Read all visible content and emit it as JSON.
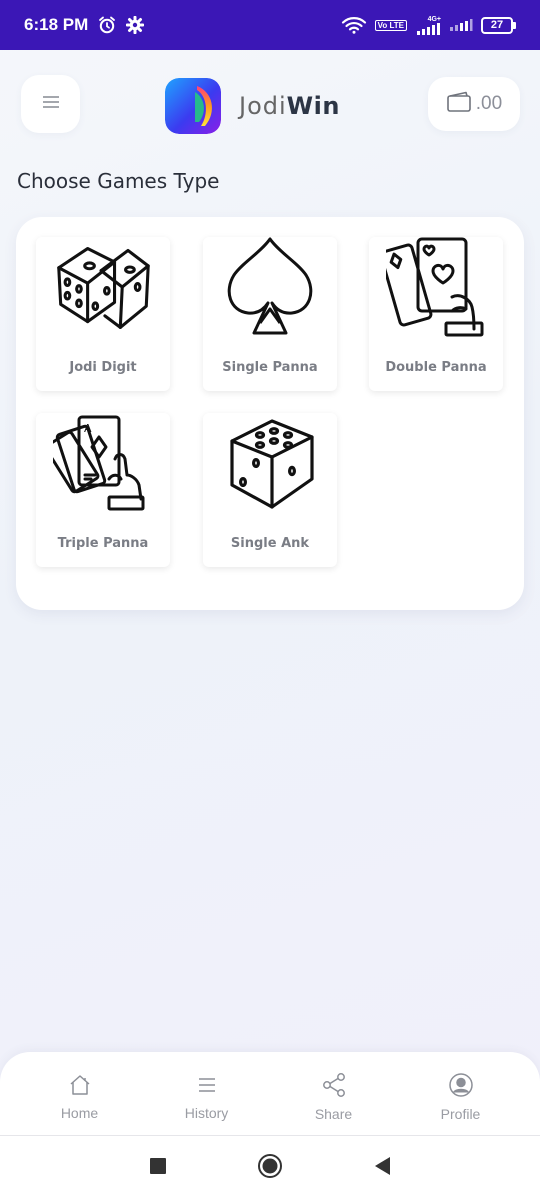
{
  "status_bar": {
    "time": "6:18 PM",
    "network": "4G+",
    "volte": "Vo LTE",
    "battery": "27",
    "icons": [
      "alarm-icon",
      "settings-icon",
      "wifi-icon",
      "signal-icon",
      "battery-icon"
    ]
  },
  "header": {
    "brand_part1": "Jodi",
    "brand_part2": "Win",
    "wallet_amount": ".00",
    "menu_icon": "menu-icon",
    "wallet_icon": "wallet-icon"
  },
  "section_title": "Choose Games Type",
  "games": [
    {
      "label": "Jodi Digit",
      "icon": "dice-pair-icon"
    },
    {
      "label": "Single Panna",
      "icon": "spade-icon"
    },
    {
      "label": "Double Panna",
      "icon": "cards-hand-icon"
    },
    {
      "label": "Triple Panna",
      "icon": "card-fan-icon"
    },
    {
      "label": "Single Ank",
      "icon": "single-die-icon"
    }
  ],
  "bottom_nav": [
    {
      "label": "Home",
      "icon": "home-icon"
    },
    {
      "label": "History",
      "icon": "history-icon"
    },
    {
      "label": "Share",
      "icon": "share-icon"
    },
    {
      "label": "Profile",
      "icon": "profile-icon"
    }
  ],
  "colors": {
    "status_bar": "#3b17b6",
    "card_bg": "#ffffff",
    "label_gray": "#7a7d85",
    "brand_dark": "#2c3545"
  }
}
